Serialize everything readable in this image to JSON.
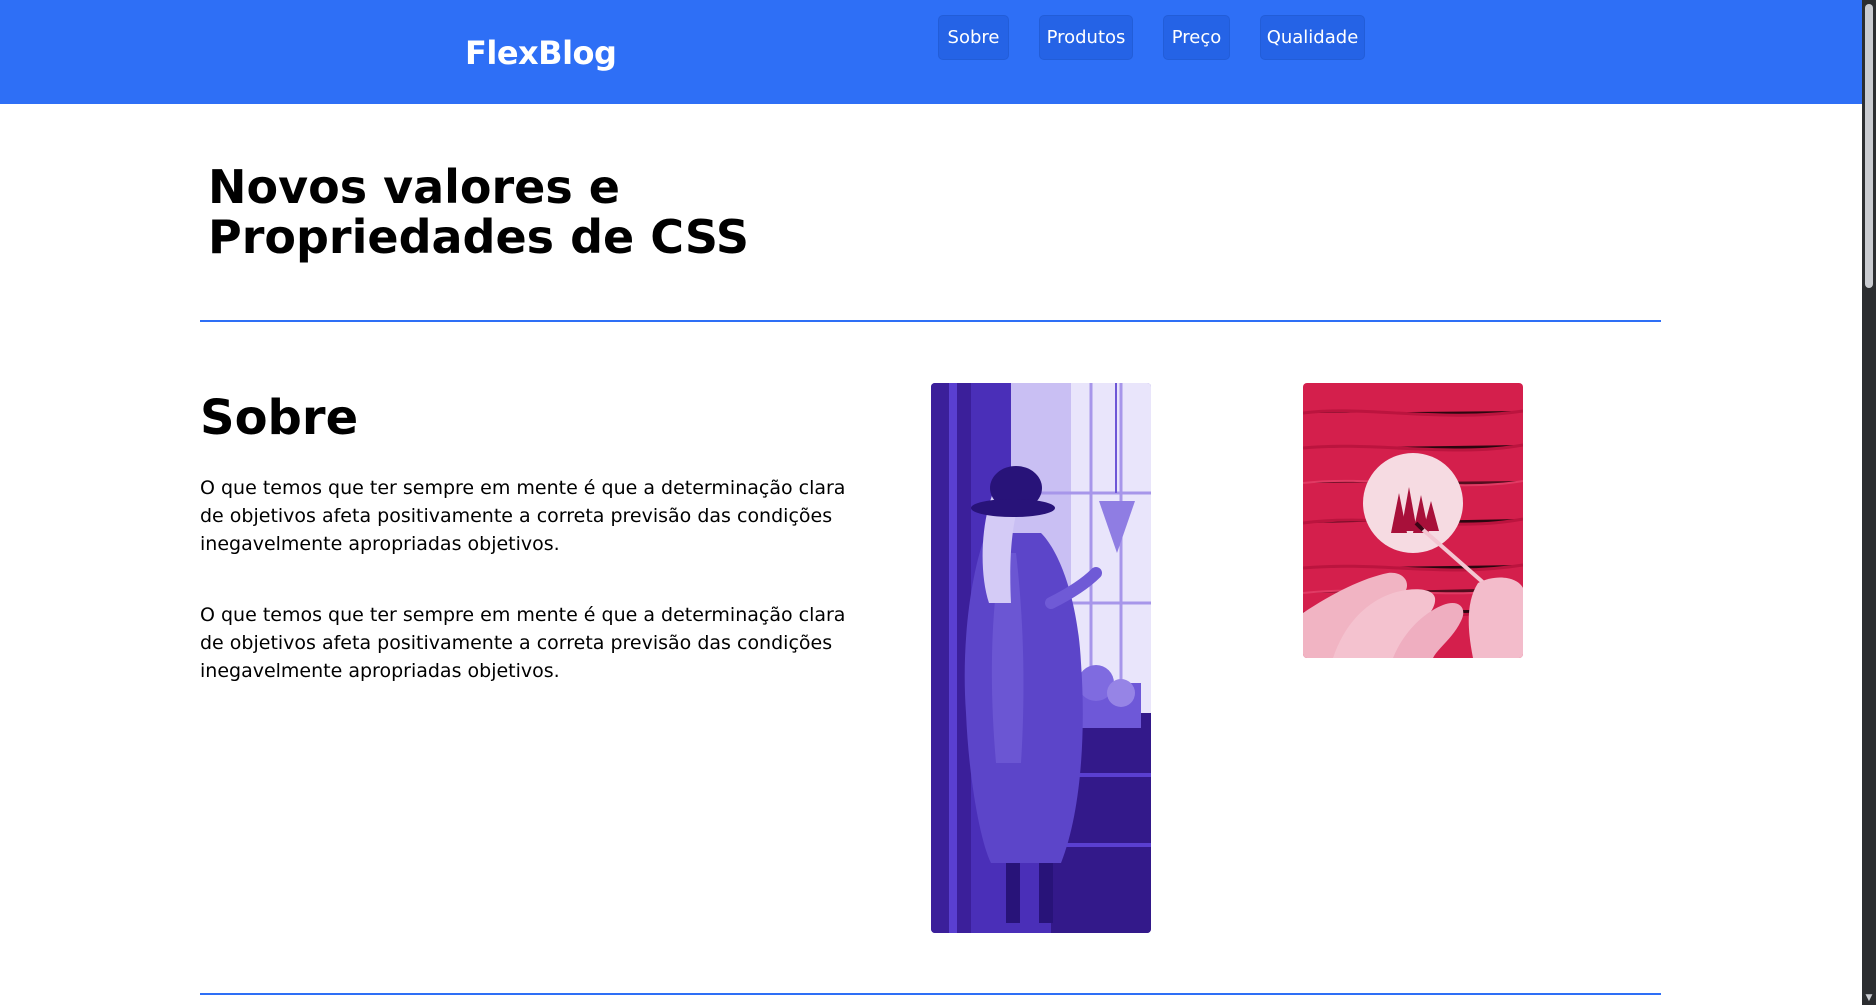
{
  "header": {
    "brand": "FlexBlog",
    "nav": [
      {
        "label": "Sobre"
      },
      {
        "label": "Produtos"
      },
      {
        "label": "Preço"
      },
      {
        "label": "Qualidade"
      }
    ]
  },
  "main": {
    "title_line1": "Novos valores e",
    "title_line2": "Propriedades de CSS",
    "section": {
      "title": "Sobre",
      "paragraphs": [
        "O que temos que ter sempre em mente é que a determinação clara de objetivos afeta positivamente a correta previsão das condições inegavelmente apropriadas objetivos.",
        "O que temos que ter sempre em mente é que a determinação clara de objetivos afeta positivamente a correta previsão das condições inegavelmente apropriadas objetivos."
      ]
    }
  },
  "colors": {
    "accent": "#2e6ff6",
    "nav_button": "#2563e6",
    "photo1_tint": "#5a3fd1",
    "photo2_tint": "#e8275a"
  },
  "icons": {
    "scroll_down": "chevron-down-icon"
  }
}
